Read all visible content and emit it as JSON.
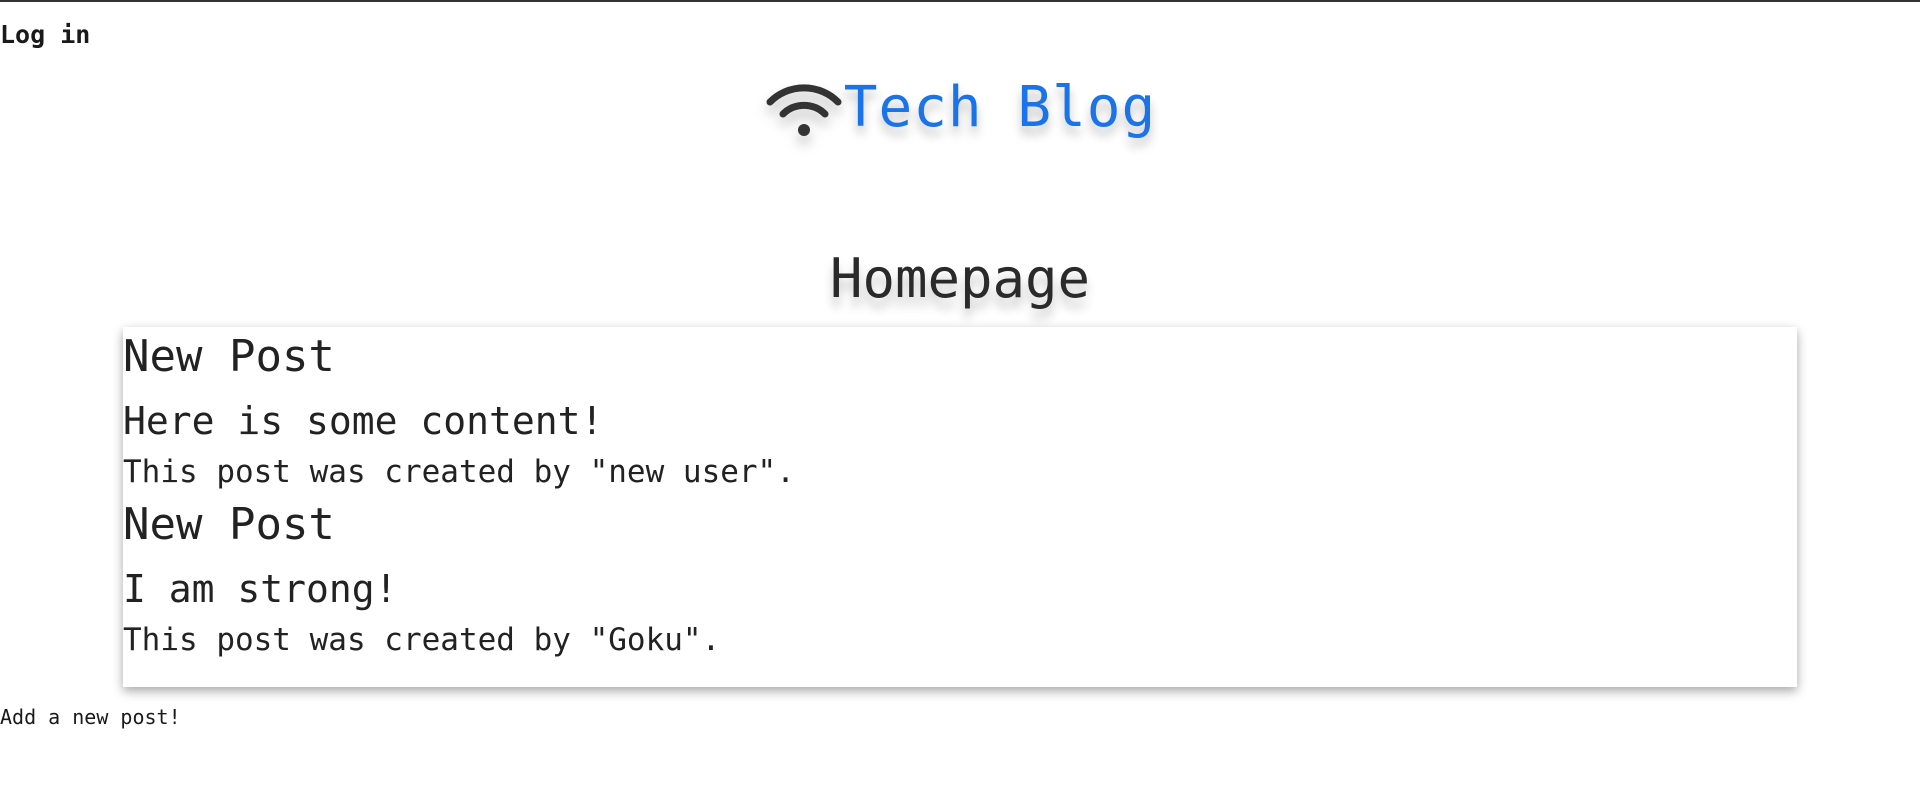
{
  "nav": {
    "login_label": "Log in"
  },
  "brand": {
    "title": "Tech Blog",
    "icon": "wifi-icon",
    "title_color": "#1a73e8"
  },
  "page": {
    "heading": "Homepage"
  },
  "posts": [
    {
      "title": "New Post",
      "content": "Here is some content!",
      "author_line": "This post was created by \"new user\"."
    },
    {
      "title": "New Post",
      "content": "I am strong!",
      "author_line": "This post was created by \"Goku\"."
    }
  ],
  "footer": {
    "add_post_label": "Add a new post!"
  }
}
